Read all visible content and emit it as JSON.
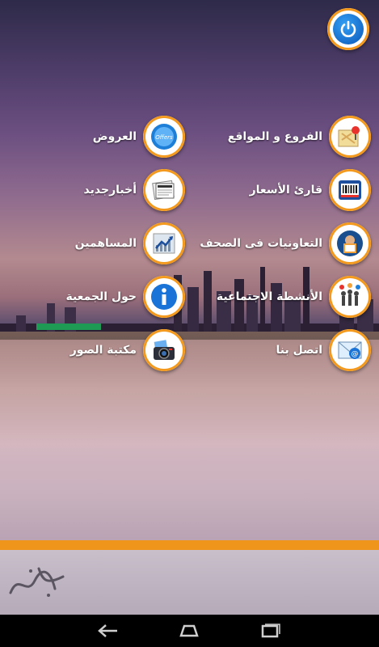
{
  "menu": [
    {
      "id": "branches",
      "label": "الفروع و المواقع",
      "icon": "map-pin-icon"
    },
    {
      "id": "offers",
      "label": "العروض",
      "icon": "offers-icon"
    },
    {
      "id": "prices",
      "label": "قارئ الأسعار",
      "icon": "barcode-icon"
    },
    {
      "id": "news",
      "label": "أخبارجديد",
      "icon": "newspaper-icon"
    },
    {
      "id": "press",
      "label": "التعاونيات فى الصحف",
      "icon": "press-man-icon"
    },
    {
      "id": "shareholders",
      "label": "المساهمين",
      "icon": "chart-icon"
    },
    {
      "id": "social",
      "label": "الأنشطة الاجتماعية",
      "icon": "people-icon"
    },
    {
      "id": "about",
      "label": "حول الجمعية",
      "icon": "info-icon"
    },
    {
      "id": "contact",
      "label": "اتصل بنا",
      "icon": "email-icon"
    },
    {
      "id": "gallery",
      "label": "مكتبة الصور",
      "icon": "camera-icon"
    }
  ],
  "offers_icon_text": "Offers",
  "colors": {
    "accent": "#f39a1e",
    "button_blue": "#0a56b8"
  }
}
